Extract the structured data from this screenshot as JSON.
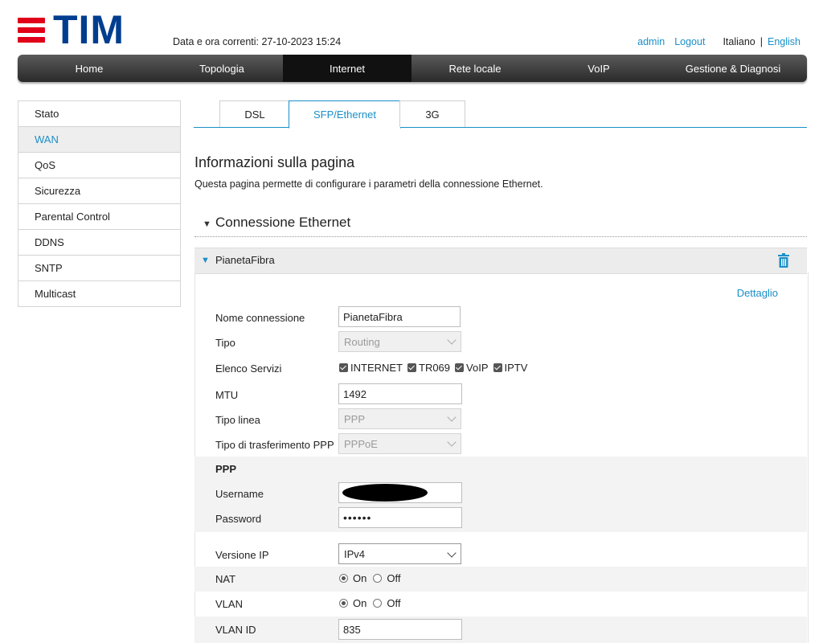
{
  "header": {
    "logo_text": "TIM",
    "datetime": "Data e ora correnti: 27-10-2023 15:24",
    "user": "admin",
    "logout": "Logout",
    "lang_current": "Italiano",
    "lang_sep": "|",
    "lang_other": "English"
  },
  "nav": {
    "items": [
      "Home",
      "Topologia",
      "Internet",
      "Rete locale",
      "VoIP",
      "Gestione & Diagnosi"
    ],
    "active": "Internet"
  },
  "sidebar": {
    "items": [
      "Stato",
      "WAN",
      "QoS",
      "Sicurezza",
      "Parental Control",
      "DDNS",
      "SNTP",
      "Multicast"
    ],
    "active": "WAN"
  },
  "tabs": {
    "items": [
      "DSL",
      "SFP/Ethernet",
      "3G"
    ],
    "active": "SFP/Ethernet"
  },
  "page": {
    "title": "Informazioni sulla pagina",
    "description": "Questa pagina permette di configurare i parametri della connessione Ethernet.",
    "section": "Connessione Ethernet"
  },
  "connection": {
    "name": "PianetaFibra",
    "detail_link": "Dettaglio",
    "fields": {
      "nome_label": "Nome connessione",
      "nome_value": "PianetaFibra",
      "tipo_label": "Tipo",
      "tipo_value": "Routing",
      "servizi_label": "Elenco Servizi",
      "servizi": [
        "INTERNET",
        "TR069",
        "VoIP",
        "IPTV"
      ],
      "mtu_label": "MTU",
      "mtu_value": "1492",
      "tipo_linea_label": "Tipo linea",
      "tipo_linea_value": "PPP",
      "ppp_transfer_label": "Tipo di trasferimento PPP",
      "ppp_transfer_value": "PPPoE",
      "ppp_section": "PPP",
      "username_label": "Username",
      "password_label": "Password",
      "password_value": "••••••",
      "ipver_label": "Versione IP",
      "ipver_value": "IPv4",
      "nat_label": "NAT",
      "vlan_label": "VLAN",
      "on_label": "On",
      "off_label": "Off",
      "vlan_id_label": "VLAN ID",
      "vlan_id_value": "835"
    }
  },
  "colors": {
    "accent": "#1a8fc9",
    "brand_red": "#e1001a",
    "brand_blue": "#003d8f"
  }
}
